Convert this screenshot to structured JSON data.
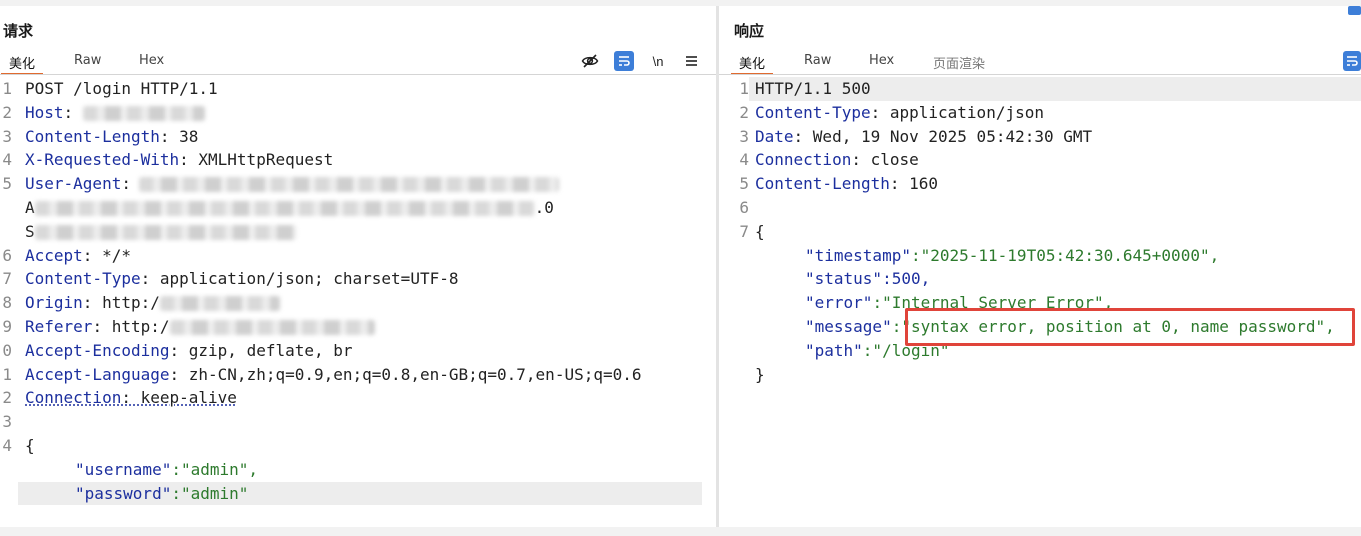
{
  "request": {
    "title": "请求",
    "tabs": [
      "美化",
      "Raw",
      "Hex"
    ],
    "toolbar": {
      "hide_icon": "eye-off-icon",
      "wrap_icon": "wrap-icon",
      "newline_label": "\\n",
      "menu_icon": "menu-icon"
    },
    "lines": [
      {
        "ln": "1",
        "key": "",
        "value": "POST /login HTTP/1.1"
      },
      {
        "ln": "2",
        "key": "Host",
        "value": ": "
      },
      {
        "ln": "3",
        "key": "Content-Length",
        "value": ": 38"
      },
      {
        "ln": "4",
        "key": "X-Requested-With",
        "value": ": XMLHttpRequest"
      },
      {
        "ln": "5",
        "key": "User-Agent",
        "value": ":"
      },
      {
        "ln": "",
        "key": "",
        "value": "A"
      },
      {
        "ln": "",
        "key": "",
        "value": "S"
      },
      {
        "ln": "6",
        "key": "Accept",
        "value": ": */*"
      },
      {
        "ln": "7",
        "key": "Content-Type",
        "value": ": application/json; charset=UTF-8"
      },
      {
        "ln": "8",
        "key": "Origin",
        "value": ": http:/"
      },
      {
        "ln": "9",
        "key": "Referer",
        "value": ": http:/"
      },
      {
        "ln": "0",
        "key": "Accept-Encoding",
        "value": ": gzip, deflate, br"
      },
      {
        "ln": "1",
        "key": "Accept-Language",
        "value": ": zh-CN,zh;q=0.9,en;q=0.8,en-GB;q=0.7,en-US;q=0.6"
      },
      {
        "ln": "2",
        "key": "Connection",
        "value": ": keep-alive"
      },
      {
        "ln": "3",
        "key": "",
        "value": ""
      },
      {
        "ln": "4",
        "key": "",
        "value": "{"
      },
      {
        "ln": "",
        "key": "\"username\"",
        "value": ":\"admin\","
      },
      {
        "ln": "",
        "key": "\"password\"",
        "value": ":\"admin\""
      }
    ],
    "ua_tail": ".0"
  },
  "response": {
    "title": "响应",
    "tabs": [
      "美化",
      "Raw",
      "Hex",
      "页面渲染"
    ],
    "toolbar": {
      "wrap_icon": "wrap-icon"
    },
    "lines": [
      {
        "ln": "1",
        "key": "",
        "value": "HTTP/1.1 500"
      },
      {
        "ln": "2",
        "key": "Content-Type",
        "value": ": application/json"
      },
      {
        "ln": "3",
        "key": "Date",
        "value": ": Wed, 19 Nov 2025 05:42:30 GMT"
      },
      {
        "ln": "4",
        "key": "Connection",
        "value": ": close"
      },
      {
        "ln": "5",
        "key": "Content-Length",
        "value": ": 160"
      },
      {
        "ln": "6",
        "key": "",
        "value": ""
      },
      {
        "ln": "7",
        "key": "",
        "value": "{"
      },
      {
        "ln": "",
        "key": "\"timestamp\"",
        "value": ":\"2025-11-19T05:42:30.645+0000\","
      },
      {
        "ln": "",
        "key": "\"status\"",
        "value": ":500,"
      },
      {
        "ln": "",
        "key": "\"error\"",
        "value": ":\"Internal Server Error\","
      },
      {
        "ln": "",
        "key": "\"message\"",
        "value": ":\"syntax error, position at 0, name password\","
      },
      {
        "ln": "",
        "key": "\"path\"",
        "value": ":\"/login\""
      },
      {
        "ln": "",
        "key": "",
        "value": "}"
      }
    ]
  },
  "colors": {
    "accent": "#e06a2f",
    "wrap_button": "#3d7ed8",
    "highlight_box": "#e0443a",
    "json_key": "#1c2f9e",
    "json_string": "#2d7a2d"
  }
}
